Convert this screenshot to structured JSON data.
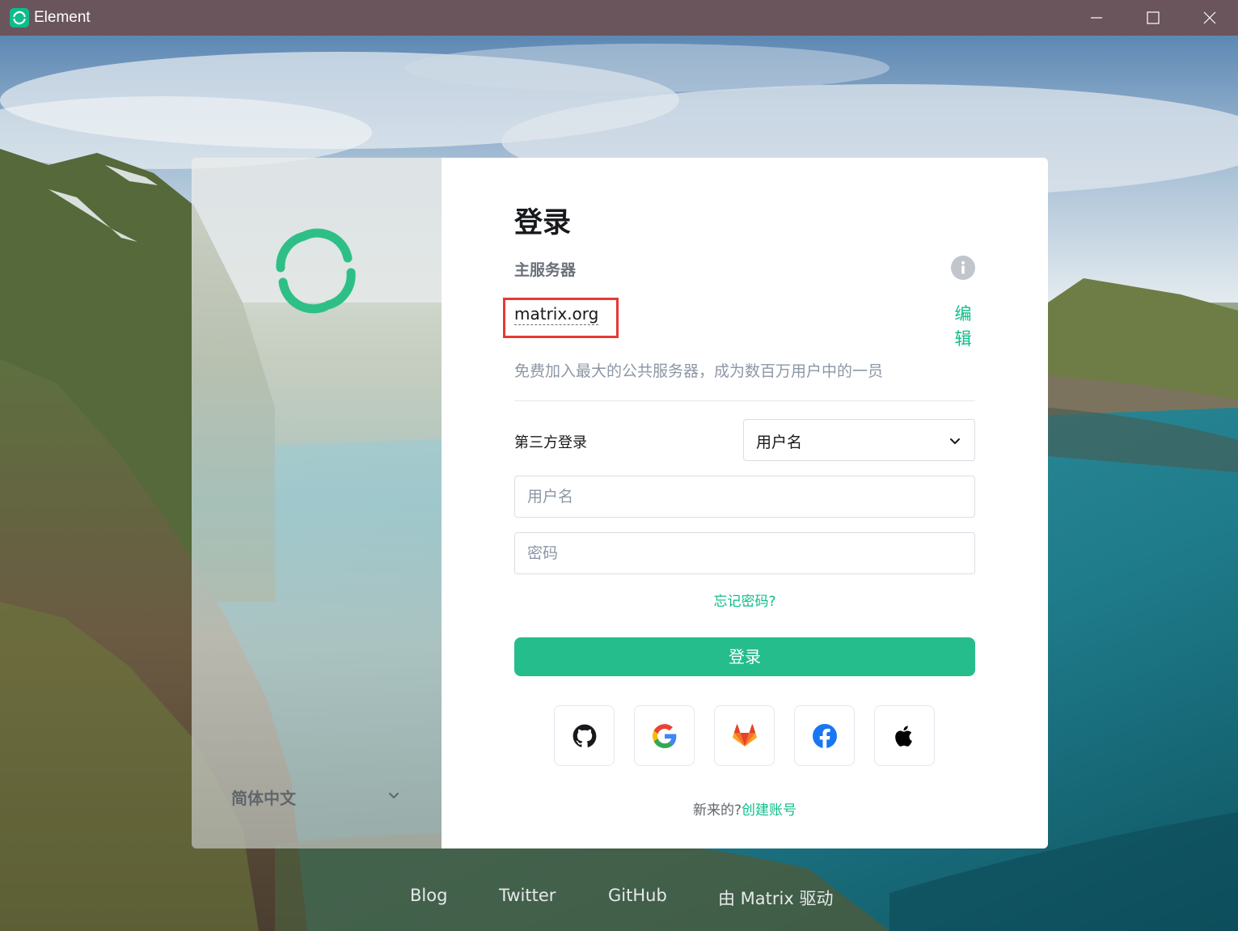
{
  "window": {
    "title": "Element",
    "controls": [
      "minimize",
      "maximize",
      "close"
    ]
  },
  "brand": {
    "accent": "#0dbd8b",
    "titlebar_color": "#6a555c",
    "highlight_color": "#e53935"
  },
  "sidebar": {
    "language": "简体中文"
  },
  "auth": {
    "title": "登录",
    "homeserver_label": "主服务器",
    "homeserver_name": "matrix.org",
    "edit_label": "编辑",
    "homeserver_description": "免费加入最大的公共服务器，成为数百万用户中的一员",
    "sso_label": "第三方登录",
    "login_type_selected": "用户名",
    "username_placeholder": "用户名",
    "password_placeholder": "密码",
    "forgot_password": "忘记密码?",
    "login_button": "登录",
    "sso_providers": [
      "github-icon",
      "google-icon",
      "gitlab-icon",
      "facebook-icon",
      "apple-icon"
    ],
    "new_user_prompt": "新来的?",
    "create_account": "创建账号"
  },
  "footer": {
    "links": [
      "Blog",
      "Twitter",
      "GitHub",
      "由 Matrix 驱动"
    ]
  }
}
